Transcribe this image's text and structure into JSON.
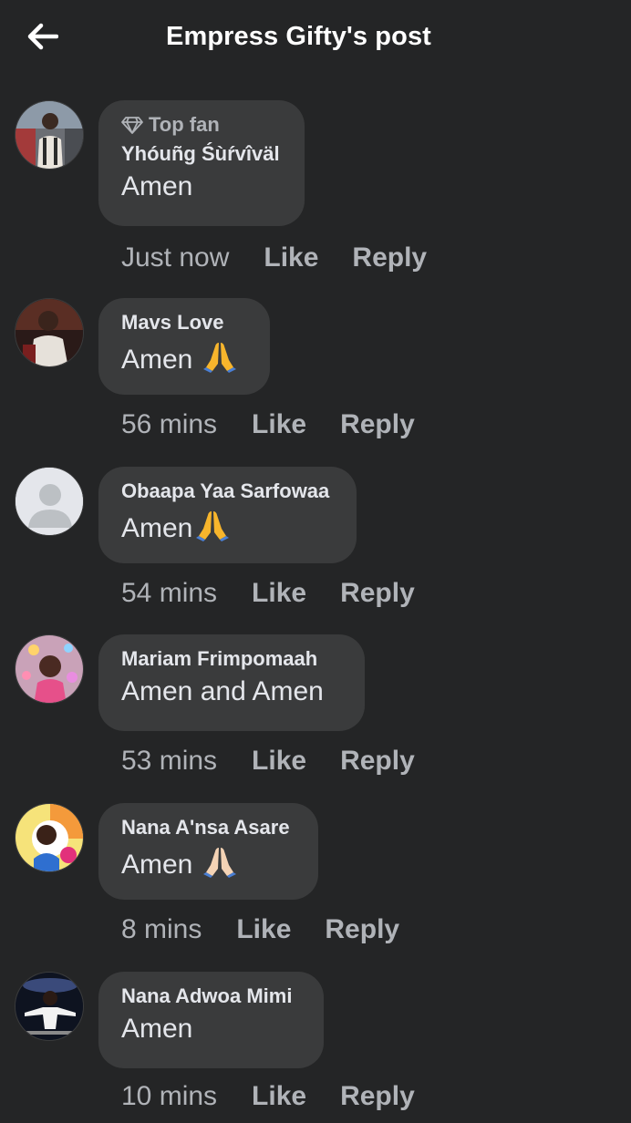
{
  "header": {
    "title": "Empress Gifty's post",
    "back_icon": "arrow-left-icon"
  },
  "comments": [
    {
      "badge": "Top fan",
      "badge_icon": "diamond-icon",
      "author": "Yhóuñg Śùŕvîväl",
      "text": "Amen",
      "time": "Just now",
      "like_label": "Like",
      "reply_label": "Reply"
    },
    {
      "author": "Mavs Love",
      "text": "Amen",
      "emoji": "folded-hands-icon",
      "time": "56 mins",
      "like_label": "Like",
      "reply_label": "Reply"
    },
    {
      "author": "Obaapa Yaa Sarfowaa",
      "text": "Amen",
      "emoji": "folded-hands-icon",
      "time": "54 mins",
      "like_label": "Like",
      "reply_label": "Reply"
    },
    {
      "author": "Mariam Frimpomaah",
      "text": "Amen and Amen",
      "time": "53 mins",
      "like_label": "Like",
      "reply_label": "Reply"
    },
    {
      "author": "Nana A'nsa Asare",
      "text": "Amen",
      "emoji": "folded-hands-light-icon",
      "time": "8 mins",
      "like_label": "Like",
      "reply_label": "Reply"
    },
    {
      "author": "Nana Adwoa Mimi",
      "text": "Amen",
      "time": "10 mins",
      "like_label": "Like",
      "reply_label": "Reply"
    }
  ],
  "colors": {
    "background": "#242526",
    "bubble": "#3a3b3c",
    "primary_text": "#e4e6eb",
    "secondary_text": "#b0b3b8"
  }
}
